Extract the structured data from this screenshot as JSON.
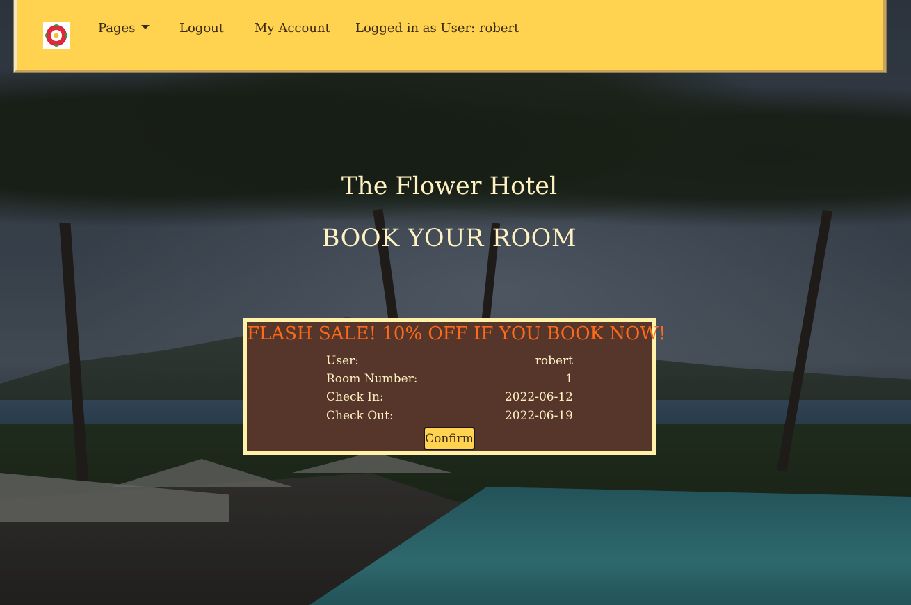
{
  "navbar": {
    "logo_icon": "tudor-rose-icon",
    "pages_label": "Pages",
    "logout_label": "Logout",
    "account_label": "My Account",
    "logged_in_text": "Logged in as User: robert"
  },
  "hero": {
    "title": "The Flower Hotel",
    "subtitle": "BOOK YOUR ROOM"
  },
  "booking": {
    "sale_banner": "FLASH SALE! 10% OFF IF YOU BOOK NOW!",
    "rows": [
      {
        "label": "User:",
        "value": "robert"
      },
      {
        "label": "Room Number:",
        "value": "1"
      },
      {
        "label": "Check In:",
        "value": "2022-06-12"
      },
      {
        "label": "Check Out:",
        "value": "2022-06-19"
      }
    ],
    "confirm_label": "Confirm"
  },
  "colors": {
    "navbar_bg": "#ffd24f",
    "card_bg": "#56362a",
    "card_border": "#fff1a8",
    "sale_text": "#ff6a1a",
    "hero_text": "#fff1c2"
  }
}
